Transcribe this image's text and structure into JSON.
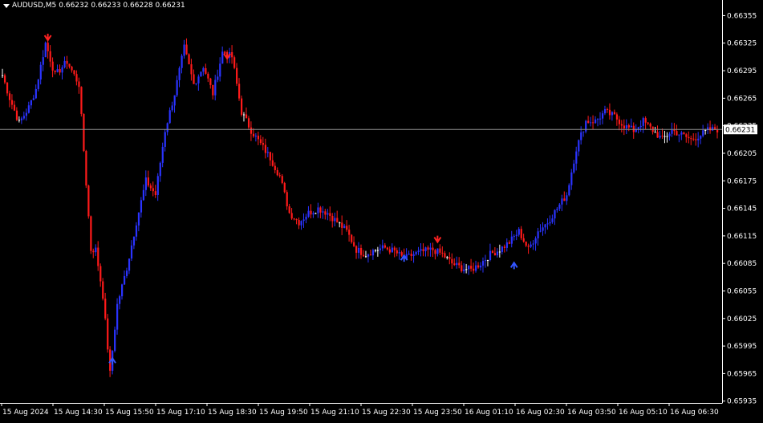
{
  "header": {
    "symbol": "AUDUSD,M5",
    "ohlc": "0.66232 0.66233 0.66228 0.66231"
  },
  "colors": {
    "background": "#000000",
    "bull": "#2a33ff",
    "bear": "#ff1a1a",
    "doji": "#ffffff",
    "axis": "#ffffff",
    "current_line": "#8c8c8c",
    "arrow_up": "#3355ff",
    "arrow_down": "#ff2222"
  },
  "chart_data": {
    "type": "candlestick",
    "symbol": "AUDUSD",
    "timeframe": "M5",
    "current_price": 0.66231,
    "current_price_label": "0.66231",
    "ylim": [
      0.65933,
      0.66372
    ],
    "y_ticks": [
      {
        "value": 0.66355,
        "label": "0.66355"
      },
      {
        "value": 0.66325,
        "label": "0.66325"
      },
      {
        "value": 0.66295,
        "label": "0.66295"
      },
      {
        "value": 0.66265,
        "label": "0.66265"
      },
      {
        "value": 0.66235,
        "label": "0.66235"
      },
      {
        "value": 0.66205,
        "label": "0.66205"
      },
      {
        "value": 0.66175,
        "label": "0.66175"
      },
      {
        "value": 0.66145,
        "label": "0.66145"
      },
      {
        "value": 0.66115,
        "label": "0.66115"
      },
      {
        "value": 0.66085,
        "label": "0.66085"
      },
      {
        "value": 0.66055,
        "label": "0.66055"
      },
      {
        "value": 0.66025,
        "label": "0.66025"
      },
      {
        "value": 0.65995,
        "label": "0.65995"
      },
      {
        "value": 0.65965,
        "label": "0.65965"
      },
      {
        "value": 0.65935,
        "label": "0.65935"
      }
    ],
    "x_labels": [
      "15 Aug 2024",
      "15 Aug 14:30",
      "15 Aug 15:50",
      "15 Aug 17:10",
      "15 Aug 18:30",
      "15 Aug 19:50",
      "15 Aug 21:10",
      "15 Aug 22:30",
      "15 Aug 23:50",
      "16 Aug 01:10",
      "16 Aug 02:30",
      "16 Aug 03:50",
      "16 Aug 05:10",
      "16 Aug 06:30"
    ],
    "anchors": [
      [
        0,
        0.6629
      ],
      [
        3,
        0.66265
      ],
      [
        7,
        0.66238
      ],
      [
        11,
        0.66255
      ],
      [
        14,
        0.66275
      ],
      [
        18,
        0.66325
      ],
      [
        22,
        0.6629
      ],
      [
        27,
        0.66305
      ],
      [
        32,
        0.6628
      ],
      [
        37,
        0.661
      ],
      [
        39,
        0.661
      ],
      [
        42,
        0.6605
      ],
      [
        45,
        0.65965
      ],
      [
        48,
        0.6604
      ],
      [
        52,
        0.6608
      ],
      [
        56,
        0.6613
      ],
      [
        60,
        0.66175
      ],
      [
        64,
        0.6616
      ],
      [
        68,
        0.6623
      ],
      [
        72,
        0.6627
      ],
      [
        76,
        0.6632
      ],
      [
        80,
        0.6628
      ],
      [
        84,
        0.663
      ],
      [
        88,
        0.6627
      ],
      [
        92,
        0.66315
      ],
      [
        96,
        0.6631
      ],
      [
        100,
        0.6625
      ],
      [
        104,
        0.6623
      ],
      [
        108,
        0.66215
      ],
      [
        112,
        0.662
      ],
      [
        116,
        0.6618
      ],
      [
        120,
        0.6614
      ],
      [
        124,
        0.6613
      ],
      [
        128,
        0.6614
      ],
      [
        132,
        0.66145
      ],
      [
        136,
        0.6614
      ],
      [
        140,
        0.6613
      ],
      [
        144,
        0.6612
      ],
      [
        148,
        0.661
      ],
      [
        152,
        0.66095
      ],
      [
        156,
        0.661
      ],
      [
        160,
        0.66102
      ],
      [
        164,
        0.66098
      ],
      [
        168,
        0.6609
      ],
      [
        172,
        0.66095
      ],
      [
        176,
        0.66098
      ],
      [
        180,
        0.661
      ],
      [
        184,
        0.66095
      ],
      [
        188,
        0.66085
      ],
      [
        192,
        0.6608
      ],
      [
        196,
        0.66078
      ],
      [
        200,
        0.66085
      ],
      [
        204,
        0.66095
      ],
      [
        208,
        0.661
      ],
      [
        212,
        0.66108
      ],
      [
        216,
        0.6612
      ],
      [
        220,
        0.661
      ],
      [
        224,
        0.6612
      ],
      [
        228,
        0.6613
      ],
      [
        232,
        0.66145
      ],
      [
        236,
        0.6616
      ],
      [
        240,
        0.6621
      ],
      [
        244,
        0.6624
      ],
      [
        248,
        0.6624
      ],
      [
        252,
        0.6625
      ],
      [
        256,
        0.66245
      ],
      [
        260,
        0.66235
      ],
      [
        264,
        0.6623
      ],
      [
        268,
        0.6624
      ],
      [
        272,
        0.6623
      ],
      [
        276,
        0.6622
      ],
      [
        280,
        0.6623
      ],
      [
        284,
        0.66225
      ],
      [
        288,
        0.6622
      ],
      [
        292,
        0.66225
      ],
      [
        295,
        0.6623
      ],
      [
        298,
        0.66231
      ]
    ],
    "signals": [
      {
        "type": "sell",
        "index": 19,
        "price": 0.6633
      },
      {
        "type": "sell",
        "index": 94,
        "price": 0.6631
      },
      {
        "type": "buy",
        "index": 46,
        "price": 0.6598
      },
      {
        "type": "sell",
        "index": 182,
        "price": 0.6611
      },
      {
        "type": "buy",
        "index": 168,
        "price": 0.66092
      },
      {
        "type": "buy",
        "index": 214,
        "price": 0.66084
      }
    ]
  }
}
